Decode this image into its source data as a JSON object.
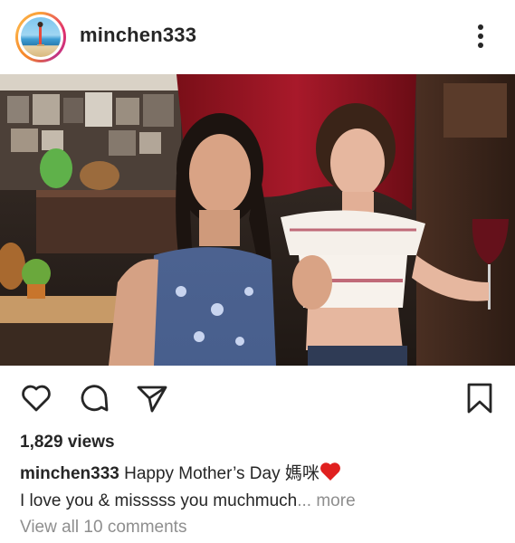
{
  "post": {
    "username": "minchen333",
    "views": "1,829 views",
    "caption_user": "minchen333",
    "caption_text": "Happy Mother’s Day 媽咪",
    "caption_line2": "I love you & misssss you muchmuch",
    "caption_ellipsis": "...",
    "more_label": "more",
    "comments_label": "View all 10 comments"
  },
  "icons": {
    "more": "more-vertical-icon",
    "like": "heart-icon",
    "comment": "comment-icon",
    "share": "send-icon",
    "save": "bookmark-icon",
    "caption_emoji": "red-heart-icon"
  },
  "colors": {
    "text": "#262626",
    "muted": "#8e8e8e",
    "heart": "#e0201f"
  }
}
